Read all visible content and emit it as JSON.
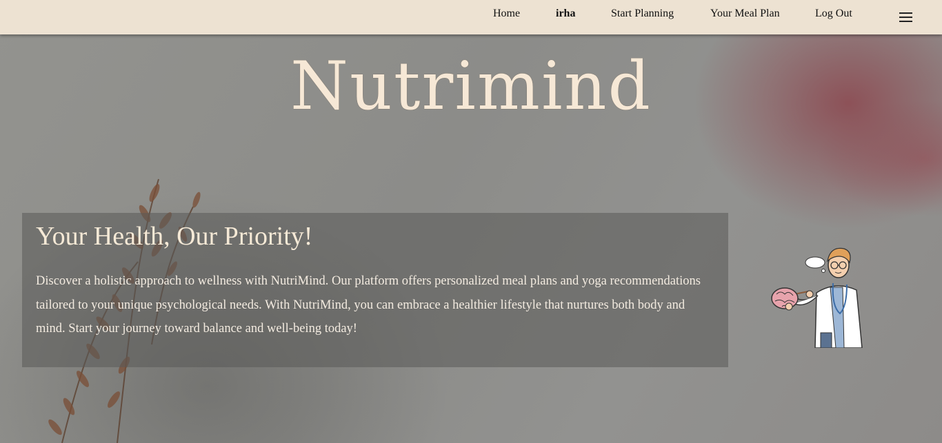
{
  "nav": {
    "links": [
      "Home",
      "irha",
      "Start Planning",
      "Your Meal Plan",
      "Log Out"
    ],
    "menu_icon": "hamburger-menu-icon"
  },
  "brand": {
    "title": "Nutrimind"
  },
  "hero": {
    "title": "Your Health, Our Priority!",
    "description": "Discover a holistic approach to wellness with NutriMind. Our platform offers personalized meal plans and yoga recommendations tailored to your unique psychological needs. With NutriMind, you can embrace a healthier lifestyle that nurtures both body and mind. Start your journey toward balance and well-being today!"
  },
  "colors": {
    "navbar": "#ede2d2",
    "brand_text": "#f6e8d6",
    "card_bg": "rgba(90,90,88,0.55)"
  }
}
